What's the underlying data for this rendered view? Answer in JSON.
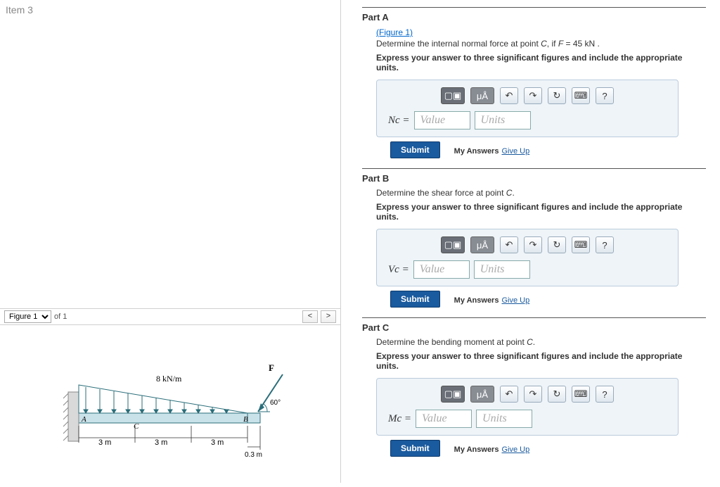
{
  "item_title": "Item 3",
  "figure_bar": {
    "selected": "Figure 1",
    "of_text": "of 1",
    "prev": "<",
    "next": ">"
  },
  "diagram": {
    "load_label": "8 kN/m",
    "F_label": "F",
    "angle": "60°",
    "A": "A",
    "B": "B",
    "C": "C",
    "d1": "3 m",
    "d2": "3 m",
    "d3": "3 m",
    "d4": "0.3 m"
  },
  "toolbar": {
    "templates": "▢▣",
    "ua": "μÅ",
    "undo": "↶",
    "redo": "↷",
    "reset": "↻",
    "keyboard": "⌨",
    "help": "?"
  },
  "common": {
    "value_ph": "Value",
    "units_ph": "Units",
    "submit": "Submit",
    "my_answers": "My Answers",
    "give_up": "Give Up",
    "instruction": "Express your answer to three significant figures and include the appropriate units."
  },
  "parts": {
    "A": {
      "header": "Part A",
      "figure_link": "(Figure 1)",
      "prompt_pre": "Determine the internal normal force at point ",
      "prompt_var": "C",
      "prompt_mid": ", if ",
      "prompt_var2": "F",
      "prompt_eq": " = 45 kN .",
      "var": "Nc ="
    },
    "B": {
      "header": "Part B",
      "prompt_pre": "Determine the shear force at point ",
      "prompt_var": "C",
      "prompt_post": ".",
      "var": "Vc ="
    },
    "C": {
      "header": "Part C",
      "prompt_pre": "Determine the bending moment at point ",
      "prompt_var": "C",
      "prompt_post": ".",
      "var": "Mc ="
    }
  }
}
